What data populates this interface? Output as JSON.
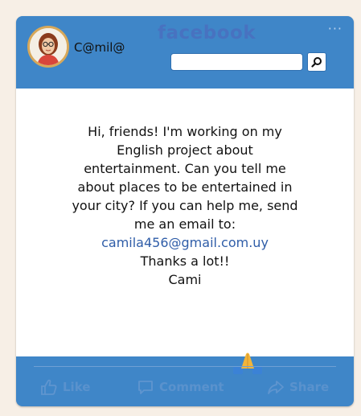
{
  "profile": {
    "username": "C@mil@"
  },
  "header": {
    "brand": "facebook",
    "more": "···",
    "search": {
      "placeholder": "",
      "value": ""
    }
  },
  "post": {
    "lines": [
      "Hi, friends! I'm working on my",
      "English project about",
      "entertainment.  Can you tell me",
      "about places to be entertained in",
      "your city?  If you can help me, send",
      "me an email to:"
    ],
    "email": "camila456@gmail.com.uy",
    "thanks": "Thanks a lot!!",
    "signature": "Cami"
  },
  "footer": {
    "actions": [
      {
        "label": "Like",
        "icon": "thumbs-up-icon"
      },
      {
        "label": "Comment",
        "icon": "comment-icon"
      },
      {
        "label": "Share",
        "icon": "share-icon"
      }
    ]
  },
  "colors": {
    "frame": "#3f86c8",
    "brand": "#4a6fbf",
    "email": "#2f5da8"
  }
}
